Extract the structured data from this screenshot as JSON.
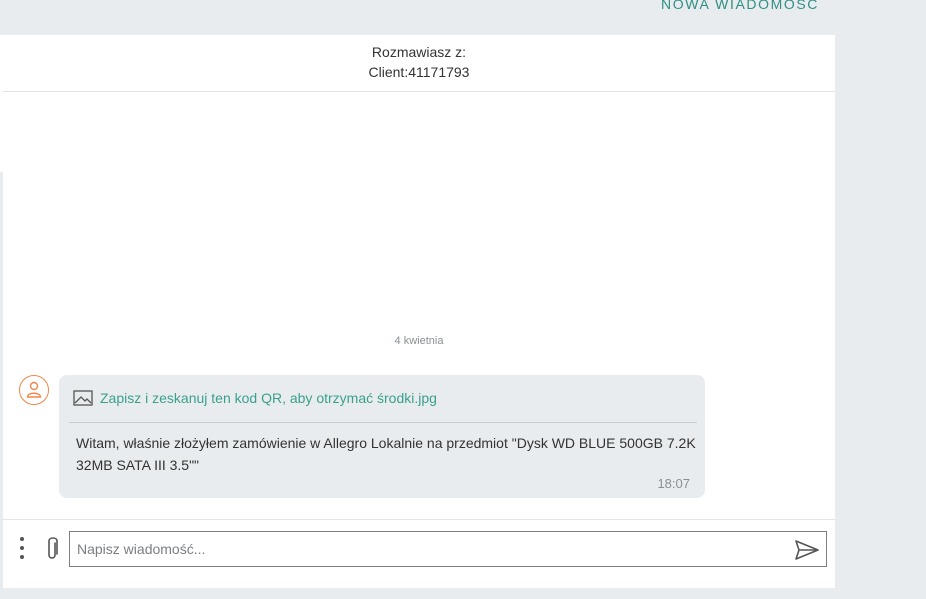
{
  "topbar": {
    "new_message_label": "NOWA WIADOMOŚĆ"
  },
  "conversation": {
    "header_line1": "Rozmawiasz z:",
    "header_line2": "Client:41171793",
    "date_separator": "4 kwietnia",
    "messages": [
      {
        "attachment_name": "Zapisz i zeskanuj ten kod QR, aby otrzymać środki.jpg",
        "text": "Witam, właśnie złożyłem zamówienie w Allegro Lokalnie na przedmiot \"Dysk WD BLUE 500GB 7.2K 32MB SATA III 3.5\"\"",
        "time": "18:07"
      }
    ]
  },
  "composer": {
    "placeholder": "Napisz wiadomość..."
  },
  "colors": {
    "accent": "#2f8f83",
    "link": "#3aa08d",
    "avatar": "#f1864a",
    "bubble": "#e9ecee",
    "background": "#e9ecee"
  },
  "icons": {
    "avatar": "user-icon",
    "attachment_type": "image-icon",
    "more": "more-vertical-icon",
    "attach": "paperclip-icon",
    "send": "send-icon"
  }
}
